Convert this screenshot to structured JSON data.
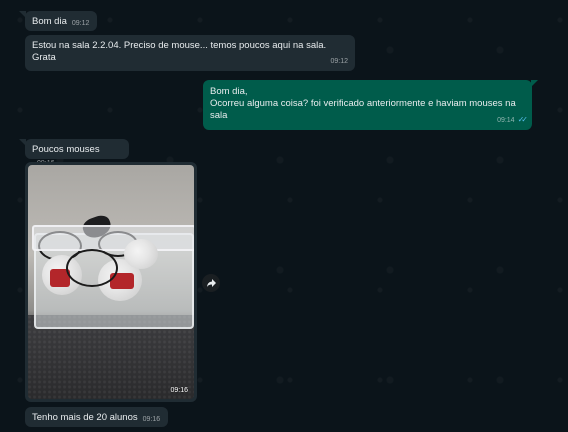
{
  "messages": [
    {
      "text": "Bom dia",
      "time": "09:12"
    },
    {
      "text_lines": [
        "Estou na sala 2.2.04. Preciso de mouse... temos poucos aqui na sala.",
        "Grata"
      ],
      "time": "09:12"
    },
    {
      "text_lines": [
        "Bom dia,",
        "Ocorreu alguma coisa? foi verificado anteriormente e haviam mouses na",
        "sala"
      ],
      "time": "09:14",
      "status_icon": "double-check-icon"
    },
    {
      "text": "Poucos mouses",
      "time": "09:16"
    },
    {
      "image_time": "09:16",
      "image_description_icon": "photo"
    },
    {
      "text": "Tenho mais de 20 alunos",
      "time": "09:16"
    }
  ],
  "forward_icon": "forward-arrow-icon",
  "colors": {
    "background": "#0b141a",
    "incoming_bubble": "#202c33",
    "outgoing_bubble": "#005c4b",
    "read_ticks": "#53bdeb"
  }
}
